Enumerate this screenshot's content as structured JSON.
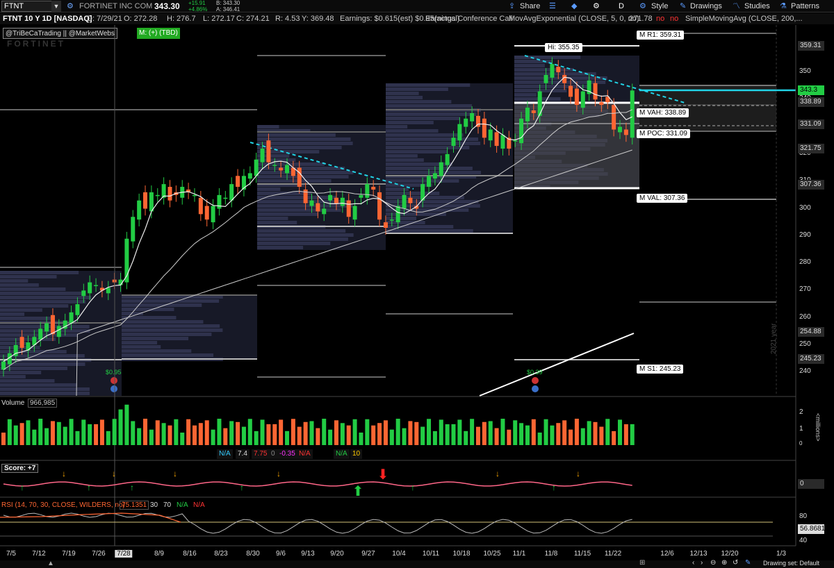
{
  "toolbar": {
    "symbol": "FTNT",
    "company": "FORTINET INC COM",
    "last": "343.30",
    "change": "+15.91",
    "change_pct": "+4.86%",
    "bid": "B: 343.30",
    "ask": "A: 346.41",
    "share": "Share",
    "aggregation": "D",
    "style": "Style",
    "drawings": "Drawings",
    "studies": "Studies",
    "patterns": "Patterns",
    "colors": {
      "up": "#22cc44",
      "down": "#ff6633",
      "accent": "#5b9bff"
    }
  },
  "info": {
    "title": "FTNT 10 Y 1D [NASDAQ]",
    "date": "D: 7/29/21",
    "open": "O: 272.28",
    "high": "H: 276.7",
    "low": "L: 272.17",
    "close": "C: 274.21",
    "range": "R: 4.53",
    "y": "Y: 369.48",
    "earnings": "Earnings: $0.615(est) $0.95(actual)",
    "call": "Earnings Conference Call",
    "ema": "MovAvgExponential (CLOSE, 5, 0, no)",
    "ema_val": "271.78",
    "no1": "no",
    "no2": "no",
    "sma": "SimpleMovingAvg (CLOSE, 200,..."
  },
  "tags": {
    "handles": "@TriBeCaTrading || @MarketWebs",
    "monthly": "M: (+)  (TBD)"
  },
  "watermark": "FORTINET",
  "levels": {
    "hi": "Hi: 355.35",
    "r1": "M R1: 359.31",
    "vah": "M VAH: 338.89",
    "poc": "M POC: 331.09",
    "val": "M VAL: 307.36",
    "s1": "M S1: 245.23"
  },
  "earnings_marks": [
    "$0.95",
    "$0.39"
  ],
  "price_axis": {
    "ticks": [
      "350",
      "340",
      "330",
      "320",
      "310",
      "300",
      "290",
      "280",
      "270",
      "260",
      "250",
      "240"
    ],
    "labels": [
      {
        "text": "359.31",
        "bg": "#2a2a2a",
        "fg": "#ddd"
      },
      {
        "text": "343.3",
        "bg": "#22cc44",
        "fg": "#000"
      },
      {
        "text": "338.89",
        "bg": "#2a2a2a",
        "fg": "#ddd"
      },
      {
        "text": "331.09",
        "bg": "#2a2a2a",
        "fg": "#ddd"
      },
      {
        "text": "321.75",
        "bg": "#2a2a2a",
        "fg": "#ddd"
      },
      {
        "text": "307.36",
        "bg": "#2a2a2a",
        "fg": "#ddd"
      },
      {
        "text": "254.88",
        "bg": "#2a2a2a",
        "fg": "#ddd"
      },
      {
        "text": "245.23",
        "bg": "#2a2a2a",
        "fg": "#ddd"
      }
    ],
    "year_label": "2021 year"
  },
  "volume": {
    "label": "Volume",
    "value": "966,985",
    "ticks": [
      "2",
      "1",
      "0"
    ],
    "units": "<millions>",
    "overlay": [
      {
        "text": "N/A",
        "color": "#33ccff"
      },
      {
        "text": "7.4",
        "color": "#dddddd"
      },
      {
        "text": "7.75",
        "color": "#ff3333"
      },
      {
        "text": "0",
        "color": "#888888"
      },
      {
        "text": "-0.35",
        "color": "#ff33ff"
      },
      {
        "text": "N/A",
        "color": "#ff3333"
      },
      {
        "text": "N/A",
        "color": "#22cc44"
      },
      {
        "text": "10",
        "color": "#ffcc00"
      }
    ]
  },
  "score": {
    "label": "Score: +7",
    "zero": "0"
  },
  "rsi": {
    "label": "RSI (14, 70, 30, CLOSE, WILDERS, no)",
    "value": "75.1351",
    "b30": "30",
    "b70": "70",
    "na1": "N/A",
    "na2": "N/A",
    "ticks": [
      "80",
      "40"
    ],
    "last": "56.8681"
  },
  "dates": [
    "7/5",
    "7/12",
    "7/19",
    "7/26",
    "7/28",
    "8/9",
    "8/16",
    "8/23",
    "8/30",
    "9/6",
    "9/13",
    "9/20",
    "9/27",
    "10/4",
    "10/11",
    "10/18",
    "10/25",
    "11/1",
    "11/8",
    "11/15",
    "11/22",
    "12/6",
    "12/13",
    "12/20",
    "1/3"
  ],
  "drawing_set": "Drawing set: Default",
  "chart_data": {
    "type": "candlestick",
    "title": "FTNT 10 Y 1D [NASDAQ]",
    "x": [
      "7/1",
      "7/2",
      "7/6",
      "7/7",
      "7/8",
      "7/9",
      "7/12",
      "7/13",
      "7/14",
      "7/15",
      "7/16",
      "7/19",
      "7/20",
      "7/21",
      "7/22",
      "7/23",
      "7/26",
      "7/27",
      "7/28",
      "7/29",
      "7/30",
      "8/2",
      "8/3",
      "8/4",
      "8/5",
      "8/6",
      "8/9",
      "8/10",
      "8/11",
      "8/12",
      "8/13",
      "8/16",
      "8/17",
      "8/18",
      "8/19",
      "8/20",
      "8/23",
      "8/24",
      "8/25",
      "8/26",
      "8/27",
      "8/30",
      "8/31",
      "9/1",
      "9/2",
      "9/3",
      "9/7",
      "9/8",
      "9/9",
      "9/10",
      "9/13",
      "9/14",
      "9/15",
      "9/16",
      "9/17",
      "9/20",
      "9/21",
      "9/22",
      "9/23",
      "9/24",
      "9/27",
      "9/28",
      "9/29",
      "9/30",
      "10/1",
      "10/4",
      "10/5",
      "10/6",
      "10/7",
      "10/8",
      "10/11",
      "10/12",
      "10/13",
      "10/14",
      "10/15",
      "10/18",
      "10/19",
      "10/20",
      "10/21",
      "10/22",
      "10/25",
      "10/26",
      "10/27",
      "10/28",
      "10/29",
      "11/1",
      "11/2",
      "11/3",
      "11/4",
      "11/5",
      "11/8",
      "11/9",
      "11/10",
      "11/11",
      "11/12",
      "11/15",
      "11/16",
      "11/17",
      "11/18",
      "11/19",
      "11/22",
      "11/23",
      "11/24"
    ],
    "close": [
      244,
      247,
      250,
      249,
      251,
      253,
      256,
      258,
      254,
      257,
      259,
      262,
      265,
      270,
      273,
      272,
      270,
      271,
      273,
      274,
      289,
      297,
      303,
      300,
      306,
      305,
      309,
      303,
      305,
      308,
      306,
      305,
      298,
      296,
      301,
      305,
      304,
      309,
      308,
      312,
      313,
      318,
      322,
      317,
      316,
      314,
      316,
      312,
      308,
      302,
      303,
      299,
      300,
      305,
      302,
      304,
      297,
      301,
      305,
      309,
      307,
      296,
      293,
      296,
      301,
      305,
      302,
      300,
      309,
      312,
      313,
      317,
      320,
      326,
      331,
      333,
      335,
      330,
      326,
      329,
      323,
      327,
      322,
      325,
      333,
      337,
      335,
      343,
      349,
      353,
      350,
      346,
      341,
      338,
      343,
      347,
      340,
      338,
      339,
      329,
      330,
      327,
      343.3
    ],
    "ema5_last": 271.78,
    "levels": {
      "R1": 359.31,
      "VAH": 338.89,
      "POC": 331.09,
      "VAL": 307.36,
      "S1": 245.23,
      "Hi": 355.35
    },
    "ylim": [
      230,
      365
    ],
    "rsi_last": 56.8681
  }
}
